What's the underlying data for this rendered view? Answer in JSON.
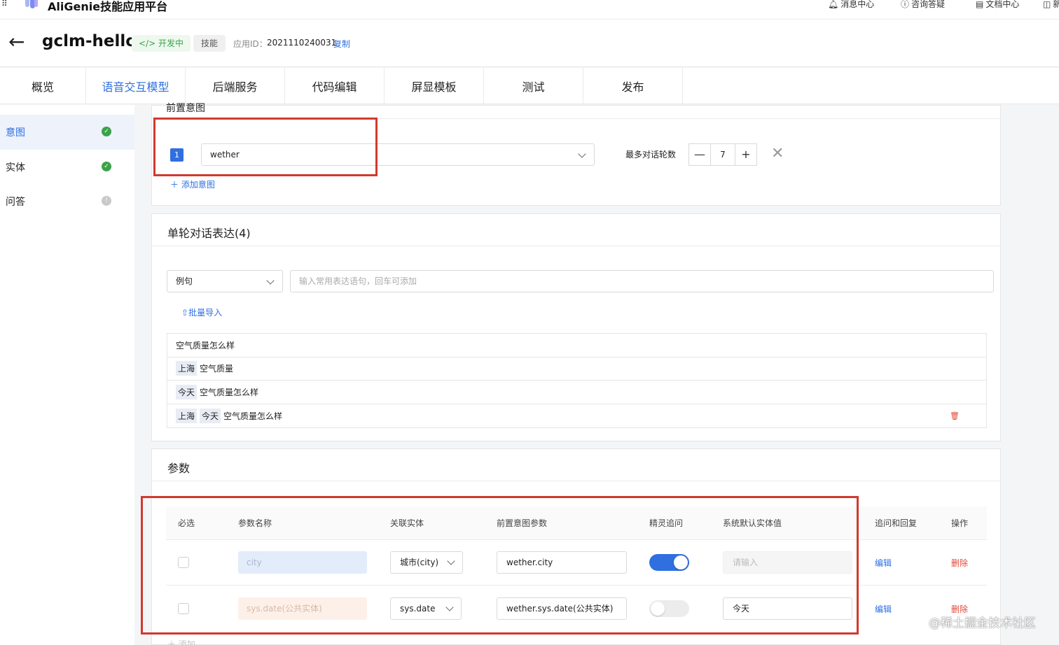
{
  "topbar": {
    "app_title": "AliGenie技能应用平台",
    "links": [
      "消息中心",
      "咨询答疑",
      "文档中心",
      "新"
    ]
  },
  "header": {
    "project_name": "gclm-hello",
    "status_badge": "开发中",
    "type_badge": "技能",
    "appid_label": "应用ID：",
    "appid_value": "2021110240031",
    "copy_label": "复制"
  },
  "tabs": [
    "概览",
    "语音交互模型",
    "后端服务",
    "代码编辑",
    "屏显模板",
    "测试",
    "发布"
  ],
  "active_tab": "语音交互模型",
  "sidebar": {
    "items": [
      {
        "label": "意图",
        "status": "done"
      },
      {
        "label": "实体",
        "status": "done"
      },
      {
        "label": "问答",
        "status": "info"
      }
    ]
  },
  "pre_intent": {
    "title_clip": "前置意图",
    "index": "1",
    "selected_intent": "wether",
    "max_turns_label": "最多对话轮数",
    "max_turns_value": "7",
    "minus_label": "—",
    "plus_label": "+",
    "add_label": "添加意图"
  },
  "expressions": {
    "title": "单轮对话表达(4)",
    "type_selected": "例句",
    "input_placeholder": "输入常用表达语句，回车可添加",
    "batch_import_label": "批量导入",
    "rows": [
      {
        "slots": [],
        "text": "空气质量怎么样"
      },
      {
        "slots": [
          "上海"
        ],
        "text": "空气质量"
      },
      {
        "slots": [
          "今天"
        ],
        "text": "空气质量怎么样"
      },
      {
        "slots": [
          "上海",
          "今天"
        ],
        "text": "空气质量怎么样"
      }
    ]
  },
  "params": {
    "title": "参数",
    "headers": [
      "必选",
      "参数名称",
      "关联实体",
      "前置意图参数",
      "精灵追问",
      "系统默认实体值",
      "追问和回复",
      "操作"
    ],
    "rows": [
      {
        "name": "city",
        "entity": "城市(city)",
        "pre_param": "wether.city",
        "ask": true,
        "default_value": "",
        "default_placeholder": "请输入",
        "edit": "编辑",
        "delete": "删除"
      },
      {
        "name": "sys.date(公共实体)",
        "entity": "sys.date",
        "pre_param": "wether.sys.date(公共实体)",
        "ask": false,
        "default_value": "今天",
        "default_placeholder": "",
        "edit": "编辑",
        "delete": "删除"
      }
    ],
    "add_label": "添加"
  },
  "watermark": "@稀土掘金技术社区",
  "colors": {
    "accent": "#2f6fe0",
    "success": "#3aa34a",
    "danger": "#e0483a",
    "highlight_box": "#d03a2e"
  }
}
